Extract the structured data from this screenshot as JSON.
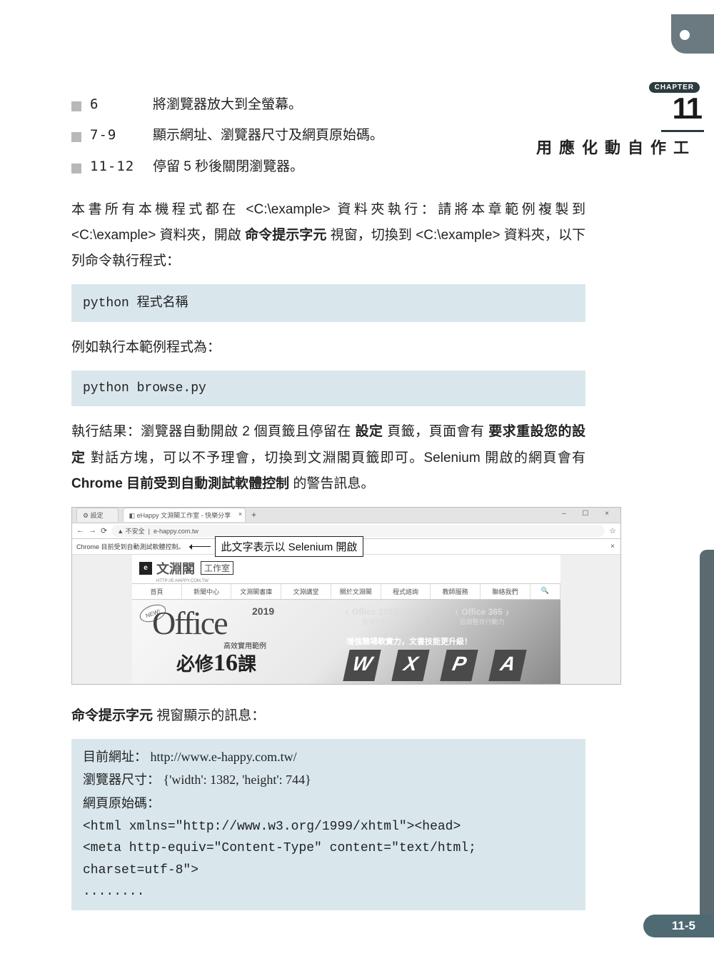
{
  "chapter": {
    "badge": "CHAPTER",
    "number": "11",
    "title": "工作自動化應用"
  },
  "bullets": [
    {
      "lines": "6",
      "text": "將瀏覽器放大到全螢幕。"
    },
    {
      "lines": "7-9",
      "text": "顯示網址、瀏覽器尺寸及網頁原始碼。"
    },
    {
      "lines": "11-12",
      "text": "停留 5 秒後關閉瀏覽器。"
    }
  ],
  "para1": {
    "s1": "本書所有本機程式都在 <C:\\example> 資料夾執行：請將本章範例複製到 <C:\\example> 資料夾，開啟 ",
    "bold1": "命令提示字元",
    "s2": " 視窗，切換到 <C:\\example> 資料夾，以下列命令執行程式："
  },
  "code1": {
    "cmd": "python ",
    "zh": "程式名稱"
  },
  "para2": "例如執行本範例程式為：",
  "code2": "python browse.py",
  "para3": {
    "s1": "執行結果：瀏覽器自動開啟 2 個頁籤且停留在 ",
    "b1": "設定",
    "s2": " 頁籤，頁面會有 ",
    "b2": "要求重設您的設定",
    "s3": " 對話方塊，可以不予理會，切換到文淵閣頁籤即可。Selenium 開啟的網頁會有 ",
    "b3": "Chrome 目前受到自動測試軟體控制",
    "s4": " 的警告訊息。"
  },
  "browser": {
    "tab_settings": "設定",
    "tab_main": "eHappy 文淵閣工作室 - 快樂分享",
    "win_ctrl": "–  ☐  ×",
    "back": "←",
    "fwd": "→",
    "reload": "⟳",
    "lock": "▲ 不安全",
    "url": "e-happy.com.tw",
    "star": "☆",
    "info_text": "Chrome 目前受到自動測試軟體控制。",
    "callout": "此文字表示以 Selenium 開啟",
    "close_x": "×",
    "logo_text": "文淵閣",
    "logo_sub": "工作室",
    "logo_sub2": "HTTP://E-HAPPY.COM.TW",
    "nav": [
      "首頁",
      "新聞中心",
      "文淵閣書庫",
      "文淵講堂",
      "關於文淵閣",
      "程式諮詢",
      "教師服務",
      "聯絡我們"
    ],
    "new_tag": "NEW!",
    "office_word": "Office",
    "year": "2019",
    "sub1": "高效實用範例",
    "bixiu_a": "必修",
    "bixiu_b": "16",
    "bixiu_c": "課",
    "laurel_left_name": "Office 2019",
    "laurel_left_sub": "重磅更新",
    "laurel_right_name": "Office 365",
    "laurel_right_sub": "雲端整合行動力",
    "laurel_x": "×",
    "tagline": "增強職場軟實力，文書技能更升級！",
    "letters": [
      "W",
      "X",
      "P",
      "A"
    ]
  },
  "para4": {
    "b": "命令提示字元",
    "s": " 視窗顯示的訊息："
  },
  "output_lines": [
    "目前網址： http://www.e-happy.com.tw/",
    "瀏覽器尺寸： {'width': 1382, 'height': 744}",
    "網頁原始碼：",
    "<html xmlns=\"http://www.w3.org/1999/xhtml\"><head>",
    "<meta http-equiv=\"Content-Type\" content=\"text/html; charset=utf-8\">",
    "........"
  ],
  "page_number": "11-5"
}
